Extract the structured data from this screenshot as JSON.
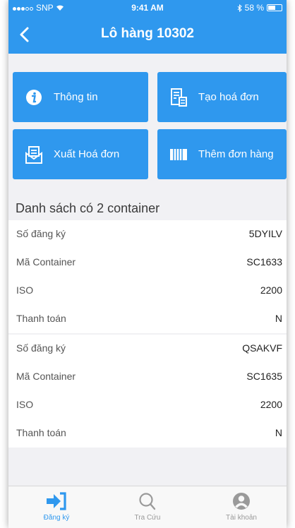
{
  "status_bar": {
    "carrier": "SNP",
    "time": "9:41 AM",
    "battery": "58 %",
    "battery_level": 0.58
  },
  "nav": {
    "title": "Lô hàng 10302",
    "back_icon": "chevron-left-icon"
  },
  "actions": [
    {
      "label": "Thông tin",
      "icon": "info-icon"
    },
    {
      "label": "Tạo hoá đơn",
      "icon": "invoice-icon"
    },
    {
      "label": "Xuất Hoá đơn",
      "icon": "envelope-export-icon"
    },
    {
      "label": "Thêm đơn hàng",
      "icon": "container-icon"
    }
  ],
  "list": {
    "title": "Danh sách có 2 container",
    "containers": [
      {
        "rows": [
          {
            "label": "Số đăng ký",
            "value": "5DYILV"
          },
          {
            "label": "Mã Container",
            "value": "SC1633"
          },
          {
            "label": "ISO",
            "value": "2200"
          },
          {
            "label": "Thanh toán",
            "value": "N"
          }
        ]
      },
      {
        "rows": [
          {
            "label": "Số đăng ký",
            "value": "QSAKVF"
          },
          {
            "label": "Mã Container",
            "value": "SC1635"
          },
          {
            "label": "ISO",
            "value": "2200"
          },
          {
            "label": "Thanh toán",
            "value": "N"
          }
        ]
      }
    ]
  },
  "tabs": [
    {
      "label": "Đăng ký",
      "icon": "sign-in-icon",
      "active": true
    },
    {
      "label": "Tra Cứu",
      "icon": "search-icon",
      "active": false
    },
    {
      "label": "Tài khoản",
      "icon": "account-icon",
      "active": false
    }
  ],
  "colors": {
    "primary": "#2f98ee",
    "background": "#f1f1f4",
    "tab_inactive": "#999999"
  }
}
